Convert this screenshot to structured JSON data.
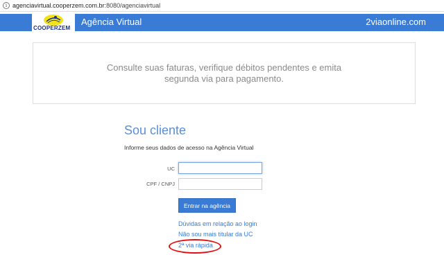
{
  "browser": {
    "url_host": "agenciavirtual.cooperzem.com.br",
    "url_rest": ":8080/agenciavirtual"
  },
  "navbar": {
    "logo_text": "COOPERZEM",
    "title": "Agência Virtual",
    "right_link": "2viaonline.com"
  },
  "banner": {
    "text": "Consulte suas faturas, verifique débitos pendentes e emita segunda via para pagamento."
  },
  "login": {
    "heading": "Sou cliente",
    "subheading": "Informe seus dados de acesso na Agência Virtual",
    "uc_label": "UC",
    "uc_value": "",
    "cpf_label": "CPF / CNPJ",
    "cpf_value": "",
    "submit_label": "Entrar na agência"
  },
  "links": {
    "doubts": "Dúvidas em relação ao login",
    "not_holder": "Não sou mais titular da UC",
    "quick_copy": "2ª via rápida"
  },
  "colors": {
    "brand_blue": "#3a7bd5",
    "annotation_red": "#e01010"
  }
}
